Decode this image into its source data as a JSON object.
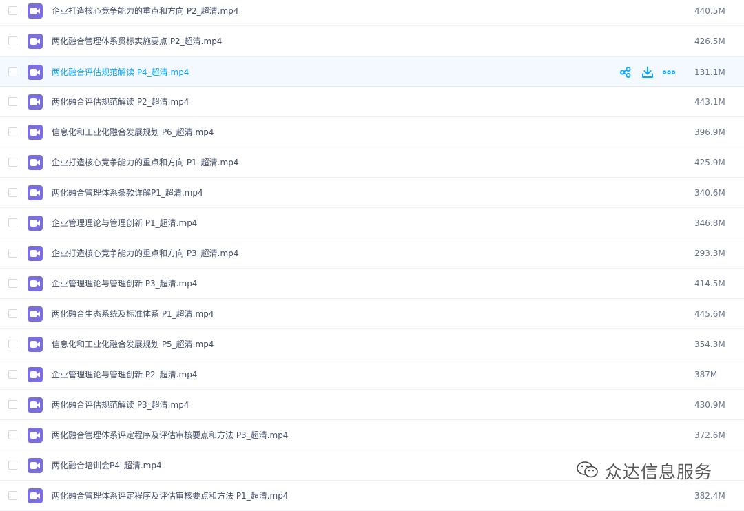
{
  "files": [
    {
      "name": "企业打造核心竞争能力的重点和方向 P2_超清.mp4",
      "size": "440.5M"
    },
    {
      "name": "两化融合管理体系贯标实施要点 P2_超清.mp4",
      "size": "426.5M"
    },
    {
      "name": "两化融合评估规范解读 P4_超清.mp4",
      "size": "131.1M",
      "hover": true
    },
    {
      "name": "两化融合评估规范解读 P2_超清.mp4",
      "size": "443.1M"
    },
    {
      "name": "信息化和工业化融合发展规划 P6_超清.mp4",
      "size": "396.9M"
    },
    {
      "name": "企业打造核心竞争能力的重点和方向 P1_超清.mp4",
      "size": "425.9M"
    },
    {
      "name": "两化融合管理体系条款详解P1_超清.mp4",
      "size": "340.6M"
    },
    {
      "name": "企业管理理论与管理创新 P1_超清.mp4",
      "size": "346.8M"
    },
    {
      "name": "企业打造核心竞争能力的重点和方向 P3_超清.mp4",
      "size": "293.3M"
    },
    {
      "name": "企业管理理论与管理创新 P3_超清.mp4",
      "size": "414.5M"
    },
    {
      "name": "两化融合生态系统及标准体系 P1_超清.mp4",
      "size": "445.6M"
    },
    {
      "name": "信息化和工业化融合发展规划 P5_超清.mp4",
      "size": "354.3M"
    },
    {
      "name": "企业管理理论与管理创新 P2_超清.mp4",
      "size": "387M"
    },
    {
      "name": "两化融合评估规范解读 P3_超清.mp4",
      "size": "430.9M"
    },
    {
      "name": "两化融合管理体系评定程序及评估审核要点和方法 P3_超清.mp4",
      "size": "372.6M"
    },
    {
      "name": "两化融合培训会P4_超清.mp4",
      "size": ""
    },
    {
      "name": "两化融合管理体系评定程序及评估审核要点和方法 P1_超清.mp4",
      "size": "382.4M"
    }
  ],
  "row_actions": [
    "share-icon",
    "download-icon",
    "more-icon"
  ],
  "watermark": {
    "text": "众达信息服务",
    "icon": "wechat-icon"
  },
  "colors": {
    "file_icon": "#7b6fe0",
    "hover_text": "#06a7ff",
    "hover_bg": "#f3f9fe",
    "text": "#424e67"
  }
}
